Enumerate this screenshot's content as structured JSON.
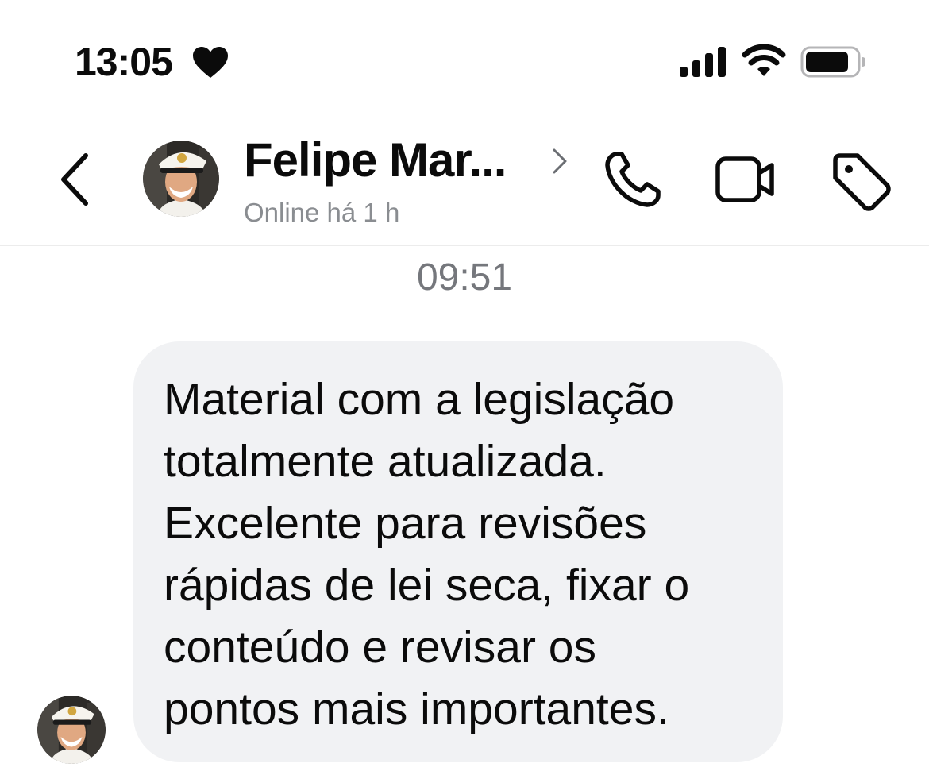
{
  "status_bar": {
    "time": "13:05",
    "focus_icon": "heart-icon",
    "signal_icon": "cellular-signal-icon",
    "wifi_icon": "wifi-icon",
    "battery_icon": "battery-icon",
    "battery_level": 0.85
  },
  "header": {
    "back_icon": "chevron-left-icon",
    "contact_name": "Felipe Mar...",
    "contact_status": "Online há 1 h",
    "chevron_icon": "chevron-right-icon",
    "actions": [
      {
        "name": "voice-call",
        "icon": "phone-icon"
      },
      {
        "name": "video-call",
        "icon": "video-camera-icon"
      },
      {
        "name": "tag",
        "icon": "tag-icon"
      }
    ]
  },
  "conversation": {
    "timestamp": "09:51",
    "messages": [
      {
        "direction": "incoming",
        "text": "Material com a legislação\ntotalmente atualizada.\nExcelente para revisões\nrápidas de lei seca, fixar o\nconteúdo e revisar os\npontos mais importantes."
      }
    ]
  },
  "colors": {
    "bubble_background": "#f1f2f4",
    "secondary_text": "#8a8d91",
    "timestamp_text": "#75777c",
    "primary_text": "#0b0b0b",
    "divider": "#ececec"
  }
}
